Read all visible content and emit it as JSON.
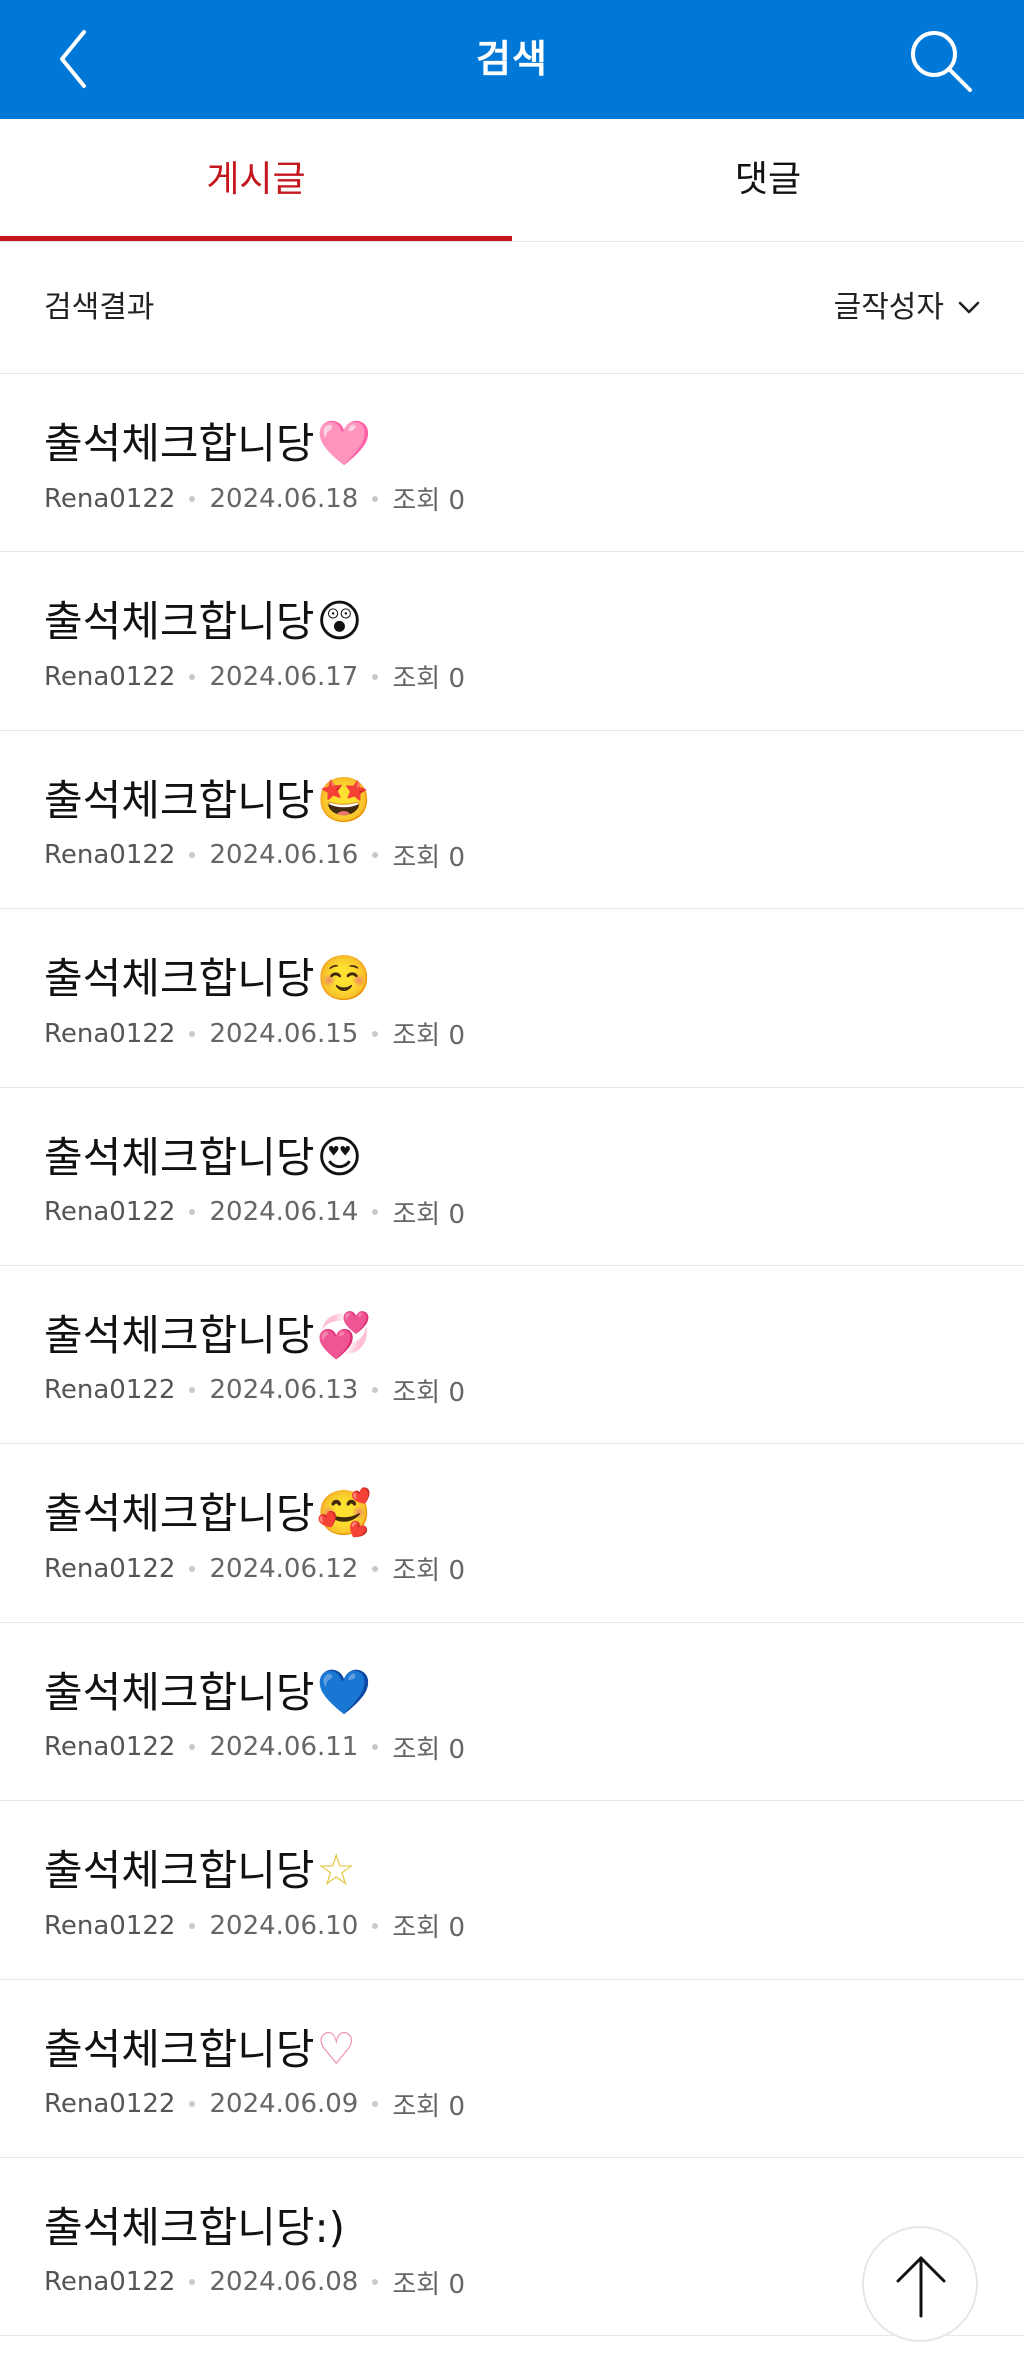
{
  "header": {
    "title": "검색",
    "back_icon": "chevron-left-icon",
    "search_icon": "search-icon",
    "background": "#0078d7"
  },
  "tabs": [
    {
      "label": "게시글",
      "active": true
    },
    {
      "label": "댓글",
      "active": false
    }
  ],
  "accent_color": "#c4161c",
  "filter": {
    "label": "검색결과",
    "sort_label": "글작성자",
    "sort_icon": "chevron-down-icon"
  },
  "posts": [
    {
      "title": "출석체크합니당",
      "emoji": "🩷",
      "author": "Rena0122",
      "date": "2024.06.18",
      "views": "조회 0"
    },
    {
      "title": "출석체크합니당",
      "emoji": "😲",
      "author": "Rena0122",
      "date": "2024.06.17",
      "views": "조회 0"
    },
    {
      "title": "출석체크합니당",
      "emoji": "🤩",
      "author": "Rena0122",
      "date": "2024.06.16",
      "views": "조회 0"
    },
    {
      "title": "출석체크합니당",
      "emoji": "☺️",
      "author": "Rena0122",
      "date": "2024.06.15",
      "views": "조회 0"
    },
    {
      "title": "출석체크합니당",
      "emoji": "😍",
      "author": "Rena0122",
      "date": "2024.06.14",
      "views": "조회 0"
    },
    {
      "title": "출석체크합니당",
      "emoji": "💞",
      "author": "Rena0122",
      "date": "2024.06.13",
      "views": "조회 0"
    },
    {
      "title": "출석체크합니당",
      "emoji": "🥰",
      "author": "Rena0122",
      "date": "2024.06.12",
      "views": "조회 0"
    },
    {
      "title": "출석체크합니당",
      "emoji": "💙",
      "author": "Rena0122",
      "date": "2024.06.11",
      "views": "조회 0"
    },
    {
      "title": "출석체크합니당",
      "emoji": "☆",
      "author": "Rena0122",
      "date": "2024.06.10",
      "views": "조회 0"
    },
    {
      "title": "출석체크합니당",
      "emoji": "♡",
      "author": "Rena0122",
      "date": "2024.06.09",
      "views": "조회 0"
    },
    {
      "title": "출석체크합니당:)",
      "emoji": "",
      "author": "Rena0122",
      "date": "2024.06.08",
      "views": "조회 0"
    }
  ],
  "scroll_top_icon": "arrow-up-icon"
}
